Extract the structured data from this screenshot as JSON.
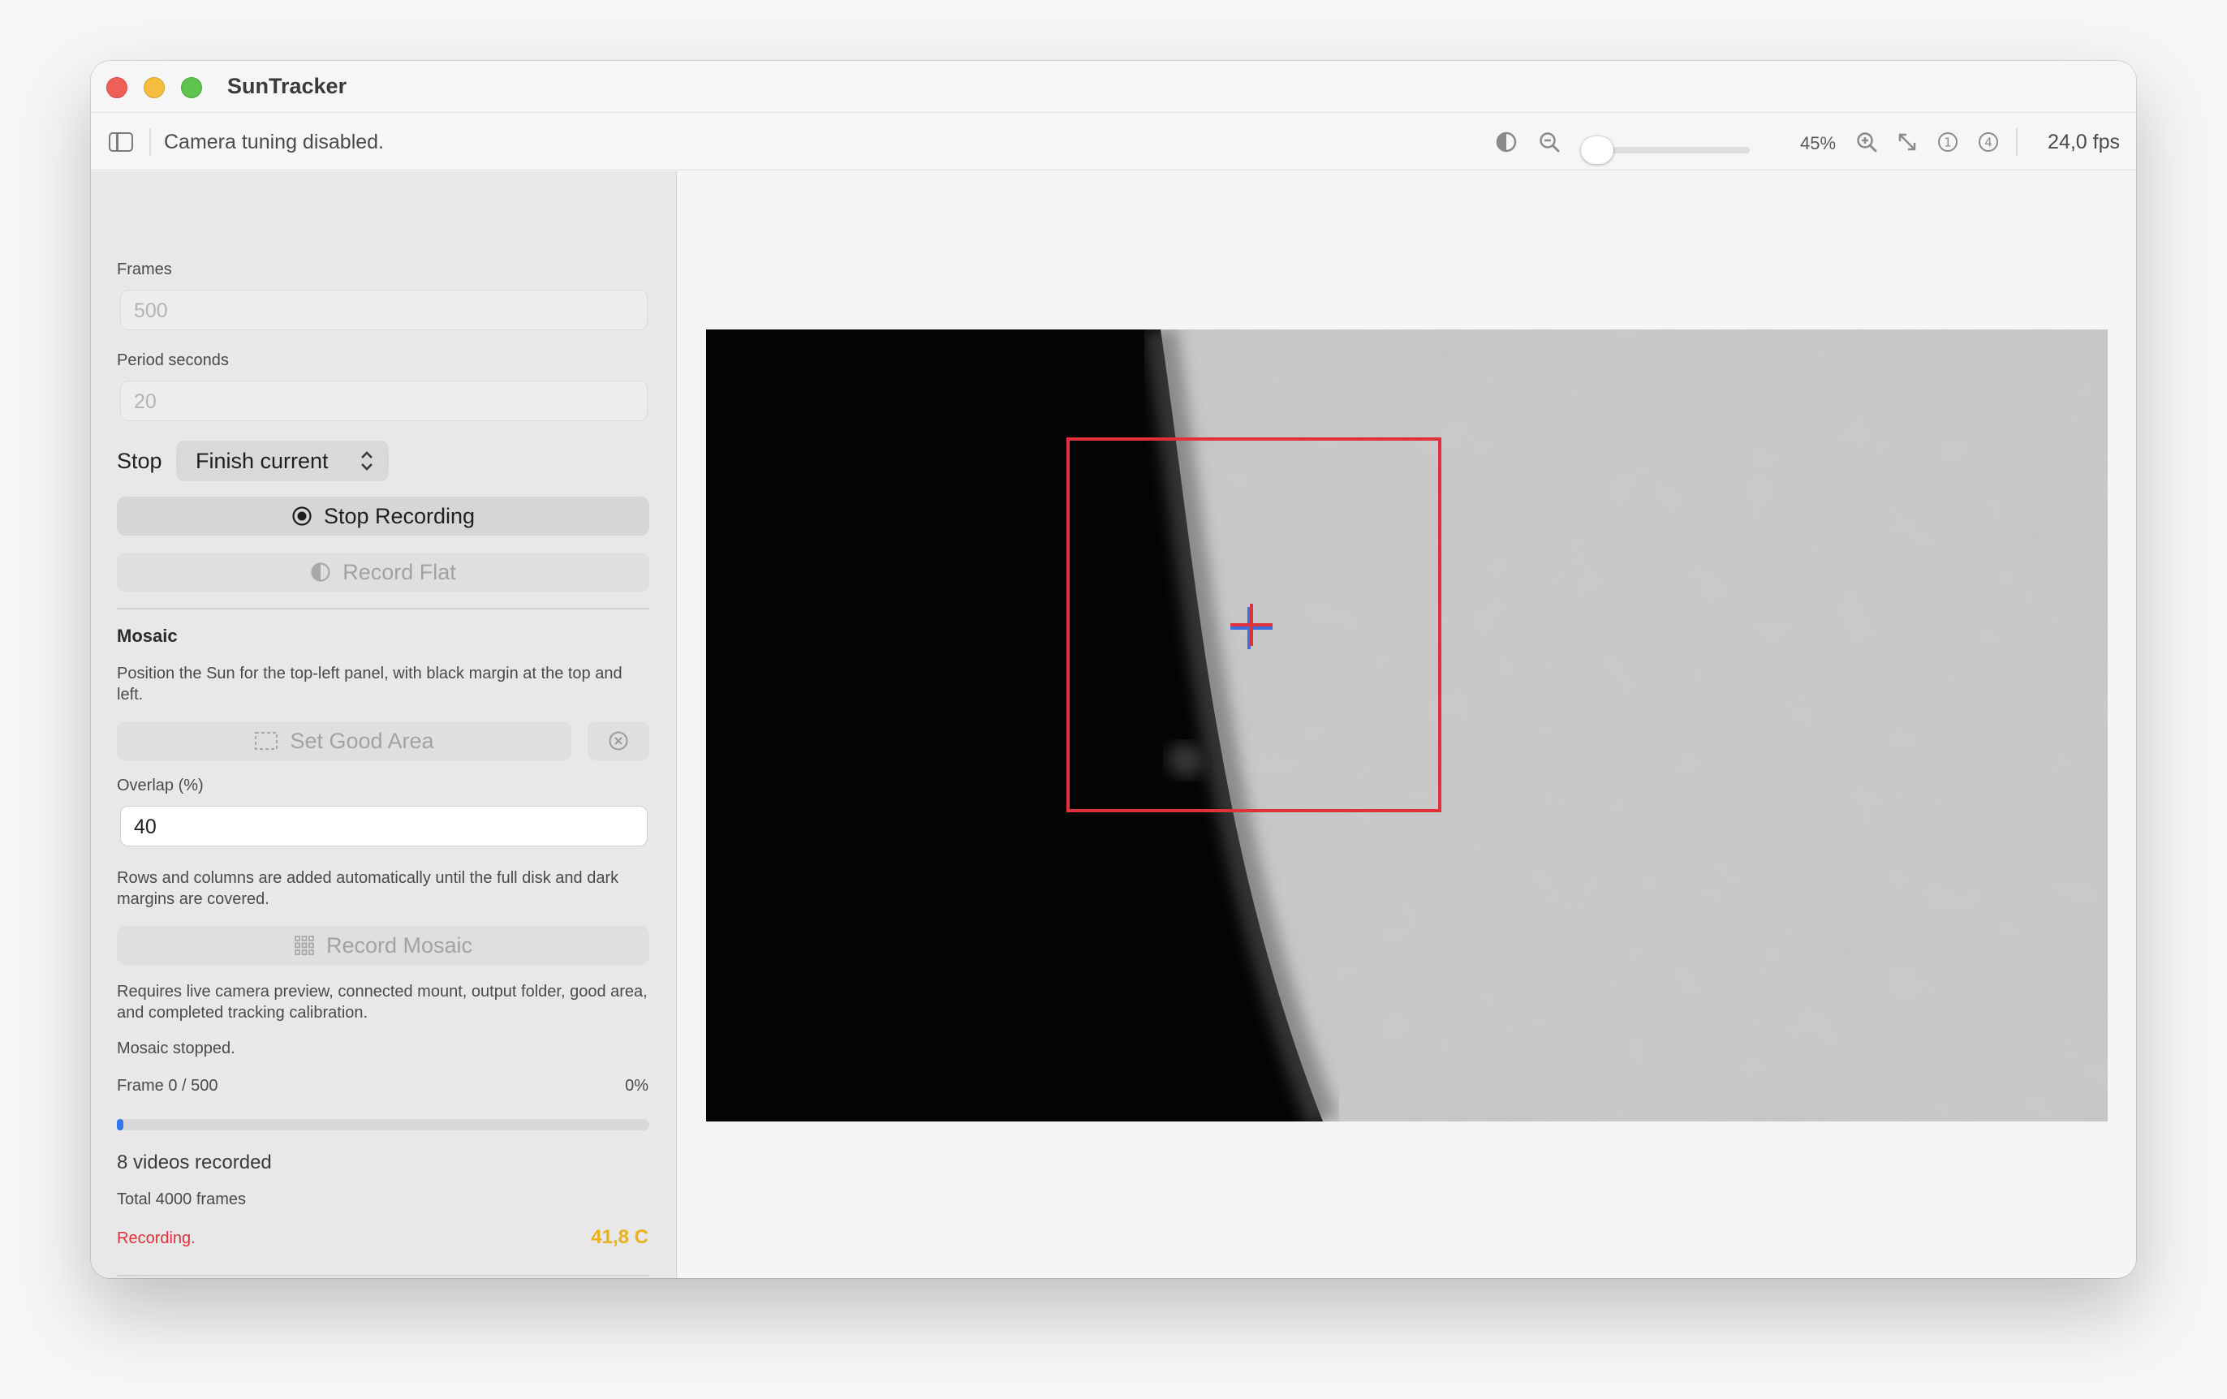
{
  "app": {
    "title": "SunTracker"
  },
  "toolbar": {
    "status": "Camera tuning disabled.",
    "zoom_percent": "45%",
    "zoom_level": 0.05,
    "fps": "24,0 fps",
    "icons": [
      "sidebar-icon",
      "contrast-icon",
      "zoom-out-icon",
      "zoom-in-icon",
      "fit-arrows-icon",
      "one-circle-icon",
      "four-circle-icon"
    ]
  },
  "sidebar": {
    "frames_label": "Frames",
    "frames_value": "500",
    "period_label": "Period seconds",
    "period_value": "20",
    "stop_label": "Stop",
    "stop_option": "Finish current",
    "stop_recording": "Stop Recording",
    "record_flat": "Record Flat",
    "mosaic_title": "Mosaic",
    "mosaic_help": "Position the Sun for the top-left panel, with black margin at the top and left.",
    "set_good_area": "Set Good Area",
    "overlap_label": "Overlap (%)",
    "overlap_value": "40",
    "rows_help": "Rows and columns are added automatically until the full disk and dark margins are covered.",
    "record_mosaic": "Record Mosaic",
    "requires_help": "Requires live camera preview, connected mount, output folder, good area, and completed tracking calibration.",
    "mosaic_status": "Mosaic stopped.",
    "frame_progress": "Frame 0 / 500",
    "percent": "0%",
    "progress_fraction": 0.0,
    "videos_recorded": "8 videos recorded",
    "total_frames": "Total 4000 frames",
    "recording_status": "Recording.",
    "temperature": "41,8 C"
  },
  "colors": {
    "recording_red": "#e0303a",
    "temperature_amber": "#e8b21a",
    "progress_blue": "#2f76f0",
    "roi_red": "#e0303a",
    "crosshair_blue": "#3a6fe0"
  }
}
